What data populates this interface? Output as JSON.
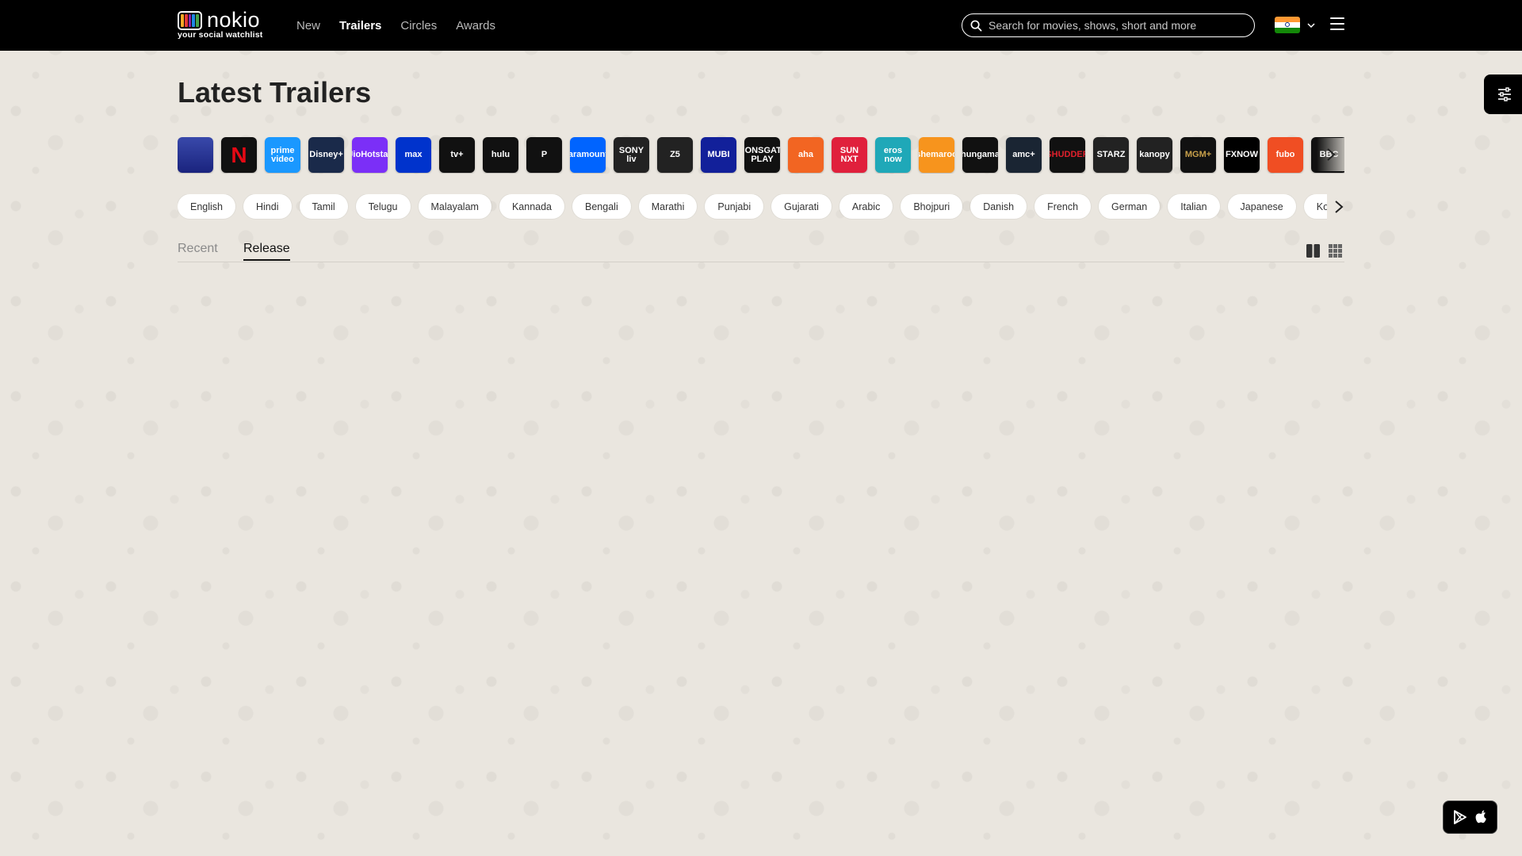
{
  "header": {
    "logo_text": "nokio",
    "logo_tagline": "your social watchlist",
    "nav": [
      {
        "label": "New",
        "active": false
      },
      {
        "label": "Trailers",
        "active": true
      },
      {
        "label": "Circles",
        "active": false
      },
      {
        "label": "Awards",
        "active": false
      }
    ],
    "search_placeholder": "Search for movies, shows, short and more",
    "country_flag": "india-flag-icon"
  },
  "page": {
    "title": "Latest Trailers"
  },
  "providers": [
    {
      "name": "theatres",
      "label": "",
      "bg": "#2b3a8c"
    },
    {
      "name": "netflix",
      "label": "N",
      "bg": "#111111",
      "fg": "#e50914"
    },
    {
      "name": "prime-video",
      "label": "prime video",
      "bg": "#1a98ff"
    },
    {
      "name": "disney-plus",
      "label": "Disney+",
      "bg": "#1a2a4a"
    },
    {
      "name": "jiohotstar",
      "label": "JioHotstar",
      "bg": "#7b2ff7"
    },
    {
      "name": "max",
      "label": "max",
      "bg": "#0033cc"
    },
    {
      "name": "apple-tv",
      "label": "tv+",
      "bg": "#111111"
    },
    {
      "name": "hulu",
      "label": "hulu",
      "bg": "#111111"
    },
    {
      "name": "peacock",
      "label": "P",
      "bg": "#111111"
    },
    {
      "name": "paramount-plus",
      "label": "Paramount+",
      "bg": "#0064ff"
    },
    {
      "name": "sony-liv",
      "label": "SONY liv",
      "bg": "#222222"
    },
    {
      "name": "zee5",
      "label": "Z5",
      "bg": "#222222"
    },
    {
      "name": "mubi",
      "label": "MUBI",
      "bg": "#12209a"
    },
    {
      "name": "lionsgate-play",
      "label": "LIONSGATE PLAY",
      "bg": "#111111"
    },
    {
      "name": "aha",
      "label": "aha",
      "bg": "#f26522"
    },
    {
      "name": "sun-nxt",
      "label": "SUN NXT",
      "bg": "#e0203c"
    },
    {
      "name": "eros-now",
      "label": "eros now",
      "bg": "#1fa8b8"
    },
    {
      "name": "shemaroo",
      "label": "shemaroo",
      "bg": "#f7941d"
    },
    {
      "name": "hungama",
      "label": "hungama",
      "bg": "#111111"
    },
    {
      "name": "amc-plus",
      "label": "amc+",
      "bg": "#1a2533"
    },
    {
      "name": "shudder",
      "label": "SHUDDER",
      "bg": "#111111",
      "fg": "#e0202c"
    },
    {
      "name": "starz",
      "label": "STARZ",
      "bg": "#222222"
    },
    {
      "name": "kanopy",
      "label": "kanopy",
      "bg": "#222222"
    },
    {
      "name": "mgm-plus",
      "label": "MGM+",
      "bg": "#111111",
      "fg": "#c8a04a"
    },
    {
      "name": "fxnow",
      "label": "FXNOW",
      "bg": "#000000"
    },
    {
      "name": "fubo",
      "label": "fubo",
      "bg": "#f04e23"
    },
    {
      "name": "bbc-iplayer",
      "label": "BBC",
      "bg": "#111111"
    }
  ],
  "languages": [
    "English",
    "Hindi",
    "Tamil",
    "Telugu",
    "Malayalam",
    "Kannada",
    "Bengali",
    "Marathi",
    "Punjabi",
    "Gujarati",
    "Arabic",
    "Bhojpuri",
    "Danish",
    "French",
    "German",
    "Italian",
    "Japanese",
    "Korean"
  ],
  "tabs": [
    {
      "label": "Recent",
      "active": false
    },
    {
      "label": "Release",
      "active": true
    }
  ],
  "colors": {
    "header_bg": "#000000",
    "page_bg": "#eae6df",
    "chip_bg": "#ffffff"
  }
}
